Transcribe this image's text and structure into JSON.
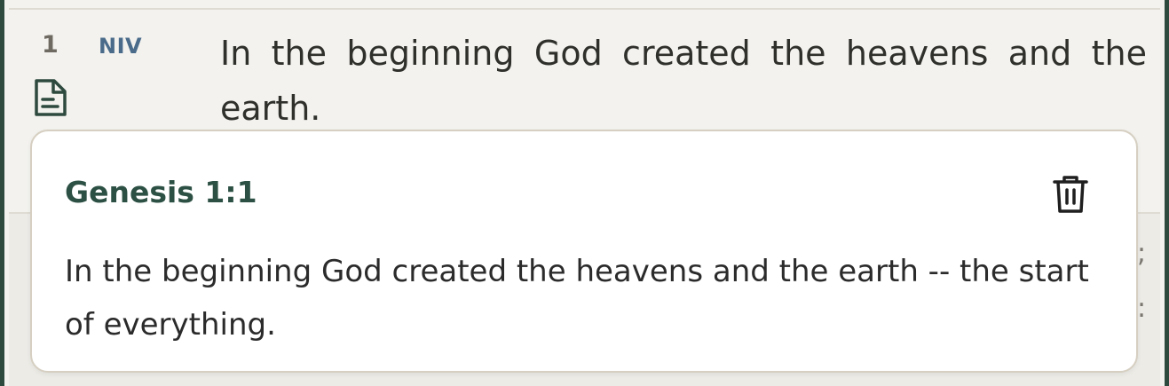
{
  "verse": {
    "number": "1",
    "version": "NIV",
    "text": "In the beginning God created the heavens and the earth.",
    "note_icon": "note-document-icon"
  },
  "note_popup": {
    "reference": "Genesis 1:1",
    "body": "In the beginning God created the heavens and the earth -- the start of everything.",
    "delete_icon": "trash-icon"
  },
  "colors": {
    "frame": "#2e4a3f",
    "title": "#2c5043",
    "version": "#4a6b8a",
    "background": "#f3f2ee",
    "popup_border": "#d6cfc2"
  }
}
